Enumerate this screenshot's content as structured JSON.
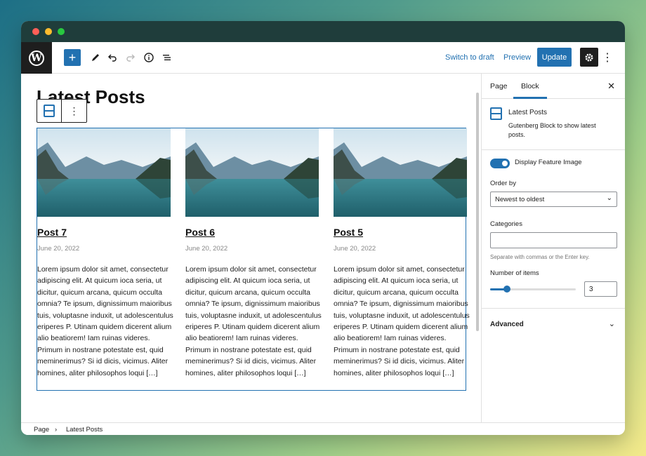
{
  "toolbar": {
    "switch_to_draft": "Switch to draft",
    "preview": "Preview",
    "update": "Update"
  },
  "editor": {
    "page_title": "Latest Posts",
    "posts": [
      {
        "title": "Post 7",
        "date": "June 20, 2022",
        "excerpt": "Lorem ipsum dolor sit amet, consectetur adipiscing elit. At quicum ioca seria, ut dicitur, quicum arcana, quicum occulta omnia? Te ipsum, dignissimum maioribus tuis, voluptasne induxit, ut adolescentulus eriperes P. Utinam quidem dicerent alium alio beatiorem! Iam ruinas videres. Primum in nostrane potestate est, quid meminerimus? Si id dicis, vicimus. Aliter homines, aliter philosophos loqui […]"
      },
      {
        "title": "Post 6",
        "date": "June 20, 2022",
        "excerpt": "Lorem ipsum dolor sit amet, consectetur adipiscing elit. At quicum ioca seria, ut dicitur, quicum arcana, quicum occulta omnia? Te ipsum, dignissimum maioribus tuis, voluptasne induxit, ut adolescentulus eriperes P. Utinam quidem dicerent alium alio beatiorem! Iam ruinas videres. Primum in nostrane potestate est, quid meminerimus? Si id dicis, vicimus. Aliter homines, aliter philosophos loqui […]"
      },
      {
        "title": "Post 5",
        "date": "June 20, 2022",
        "excerpt": "Lorem ipsum dolor sit amet, consectetur adipiscing elit. At quicum ioca seria, ut dicitur, quicum arcana, quicum occulta omnia? Te ipsum, dignissimum maioribus tuis, voluptasne induxit, ut adolescentulus eriperes P. Utinam quidem dicerent alium alio beatiorem! Iam ruinas videres. Primum in nostrane potestate est, quid meminerimus? Si id dicis, vicimus. Aliter homines, aliter philosophos loqui […]"
      }
    ]
  },
  "sidebar": {
    "tab_page": "Page",
    "tab_block": "Block",
    "block_name": "Latest Posts",
    "block_description": "Gutenberg Block to show latest posts.",
    "display_feature_image_label": "Display Feature Image",
    "display_feature_image_on": true,
    "order_by_label": "Order by",
    "order_by_value": "Newest to oldest",
    "categories_label": "Categories",
    "categories_value": "",
    "categories_help": "Separate with commas or the Enter key.",
    "number_of_items_label": "Number of items",
    "number_of_items_value": "3",
    "number_of_items_fraction": 0.2,
    "advanced_label": "Advanced"
  },
  "footer": {
    "crumb_root": "Page",
    "crumb_separator": "›",
    "crumb_current": "Latest Posts"
  },
  "colors": {
    "accent": "#2271b1",
    "dark": "#1e1e1e"
  }
}
